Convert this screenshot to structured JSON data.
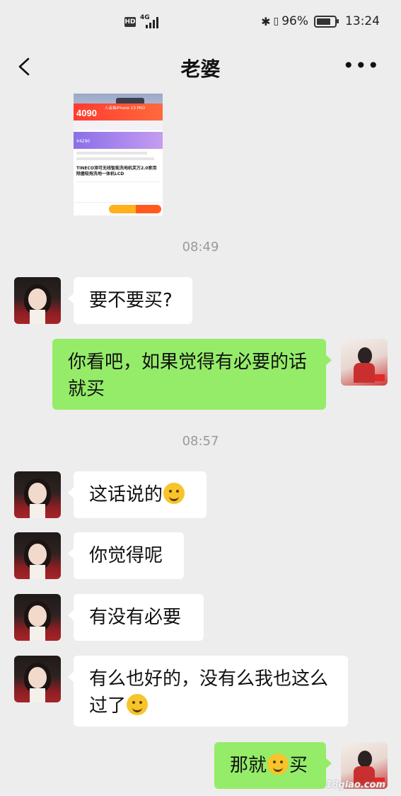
{
  "status_bar": {
    "hd": "HD",
    "network": "4G",
    "battery": "96%",
    "battery_level": 0.96,
    "time": "13:24"
  },
  "header": {
    "title": "老婆",
    "back_icon": "chevron-left-icon",
    "more_icon": "more-dots-icon",
    "more_label": "•••"
  },
  "product_card": {
    "price": "4090",
    "promo": "入会抽iPhone 13 PRO",
    "product_name": "TINECO添可无线智能洗地机芙万2.0家用除菌吸拖洗地一体机LCD",
    "price2": "¥4290"
  },
  "timestamps": [
    "08:49",
    "08:57"
  ],
  "messages": [
    {
      "side": "left",
      "text": "要不要买?"
    },
    {
      "side": "right",
      "text": "你看吧，如果觉得有必要的话就买"
    },
    {
      "side": "left",
      "text": "这话说的",
      "emoji": "facepalm"
    },
    {
      "side": "left",
      "text": "你觉得呢"
    },
    {
      "side": "left",
      "text": "有没有必要"
    },
    {
      "side": "left",
      "text": "有么也好的，没有么我也这么过了",
      "emoji": "tears-of-joy"
    },
    {
      "side": "right",
      "text_before": "那就",
      "text_after": "买",
      "emoji": "smile"
    }
  ],
  "watermark": "18giao.com"
}
